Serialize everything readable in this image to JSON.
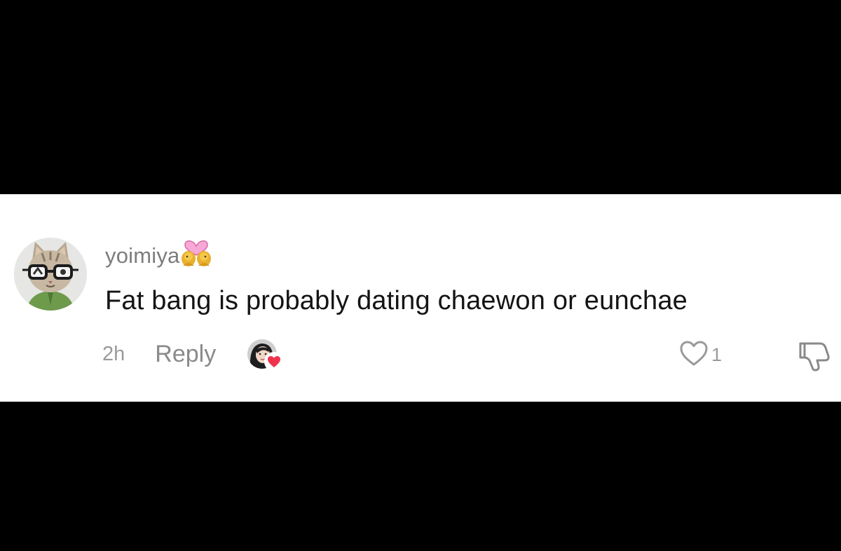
{
  "comment": {
    "username": "yoimiya",
    "username_emoji": "couple-with-heart-emoji",
    "text": "Fat bang is probably dating chaewon or eunchae",
    "timestamp": "2h",
    "reply_label": "Reply",
    "creator_liked": true,
    "like_count": "1",
    "avatar": "cat-with-glasses-avatar"
  },
  "colors": {
    "background": "#000000",
    "card": "#ffffff",
    "username": "#7d7d7d",
    "text": "#141414",
    "muted": "#9a9a9a",
    "heart_accent": "#f0334d"
  }
}
